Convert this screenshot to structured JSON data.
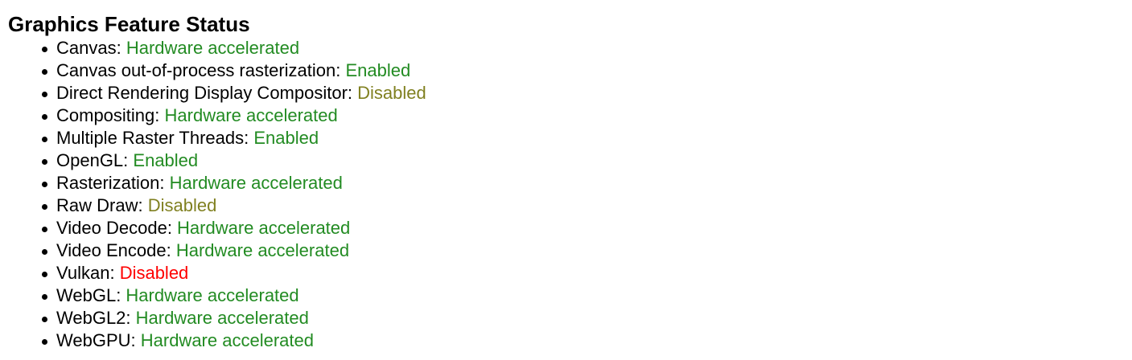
{
  "heading": "Graphics Feature Status",
  "colors": {
    "enabled": "#228b22",
    "disabled_soft": "#808020",
    "disabled_hard": "#ff0000"
  },
  "features": [
    {
      "name": "Canvas",
      "status": "Hardware accelerated",
      "level": "good"
    },
    {
      "name": "Canvas out-of-process rasterization",
      "status": "Enabled",
      "level": "good"
    },
    {
      "name": "Direct Rendering Display Compositor",
      "status": "Disabled",
      "level": "warn"
    },
    {
      "name": "Compositing",
      "status": "Hardware accelerated",
      "level": "good"
    },
    {
      "name": "Multiple Raster Threads",
      "status": "Enabled",
      "level": "good"
    },
    {
      "name": "OpenGL",
      "status": "Enabled",
      "level": "good"
    },
    {
      "name": "Rasterization",
      "status": "Hardware accelerated",
      "level": "good"
    },
    {
      "name": "Raw Draw",
      "status": "Disabled",
      "level": "warn"
    },
    {
      "name": "Video Decode",
      "status": "Hardware accelerated",
      "level": "good"
    },
    {
      "name": "Video Encode",
      "status": "Hardware accelerated",
      "level": "good"
    },
    {
      "name": "Vulkan",
      "status": "Disabled",
      "level": "bad"
    },
    {
      "name": "WebGL",
      "status": "Hardware accelerated",
      "level": "good"
    },
    {
      "name": "WebGL2",
      "status": "Hardware accelerated",
      "level": "good"
    },
    {
      "name": "WebGPU",
      "status": "Hardware accelerated",
      "level": "good"
    }
  ]
}
